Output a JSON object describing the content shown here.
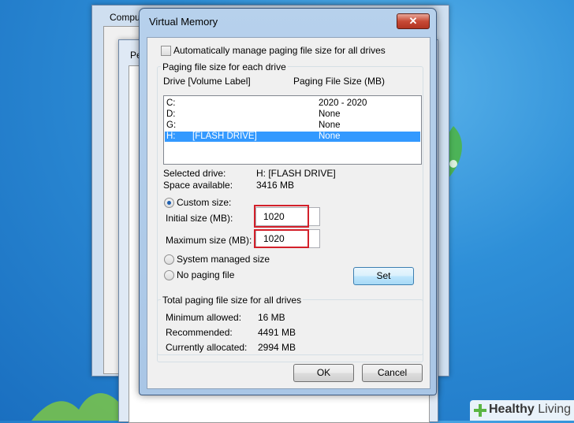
{
  "background_window": {
    "title": "Comput",
    "inner_title": "Pe"
  },
  "dialog": {
    "title": "Virtual Memory",
    "close_label": "✕",
    "auto_manage_label": "Automatically manage paging file size for all drives",
    "auto_manage_checked": false,
    "paging_group_label": "Paging file size for each drive",
    "col_drive": "Drive  [Volume Label]",
    "col_size": "Paging File Size (MB)",
    "drives": [
      {
        "drive": "C:",
        "label": "",
        "size": "2020 - 2020",
        "selected": false
      },
      {
        "drive": "D:",
        "label": "",
        "size": "None",
        "selected": false
      },
      {
        "drive": "G:",
        "label": "",
        "size": "None",
        "selected": false
      },
      {
        "drive": "H:",
        "label": "[FLASH DRIVE]",
        "size": "None",
        "selected": true
      }
    ],
    "selected_drive_label": "Selected drive:",
    "selected_drive_value": "H:  [FLASH DRIVE]",
    "space_available_label": "Space available:",
    "space_available_value": "3416 MB",
    "custom_size_label": "Custom size:",
    "initial_size_label": "Initial size (MB):",
    "initial_size_value": "1020",
    "maximum_size_label": "Maximum size (MB):",
    "maximum_size_value": "1020",
    "system_managed_label": "System managed size",
    "no_paging_label": "No paging file",
    "selected_option": "custom",
    "set_label": "Set",
    "total_group_label": "Total paging file size for all drives",
    "min_allowed_label": "Minimum allowed:",
    "min_allowed_value": "16 MB",
    "recommended_label": "Recommended:",
    "recommended_value": "4491 MB",
    "currently_allocated_label": "Currently allocated:",
    "currently_allocated_value": "2994 MB",
    "ok_label": "OK",
    "cancel_label": "Cancel"
  },
  "watermark": {
    "brand_bold": "Healthy",
    "brand_light": " Living"
  },
  "colors": {
    "highlight": "#d3202a",
    "selection": "#3399ff",
    "desktop": "#2e8fd8"
  }
}
